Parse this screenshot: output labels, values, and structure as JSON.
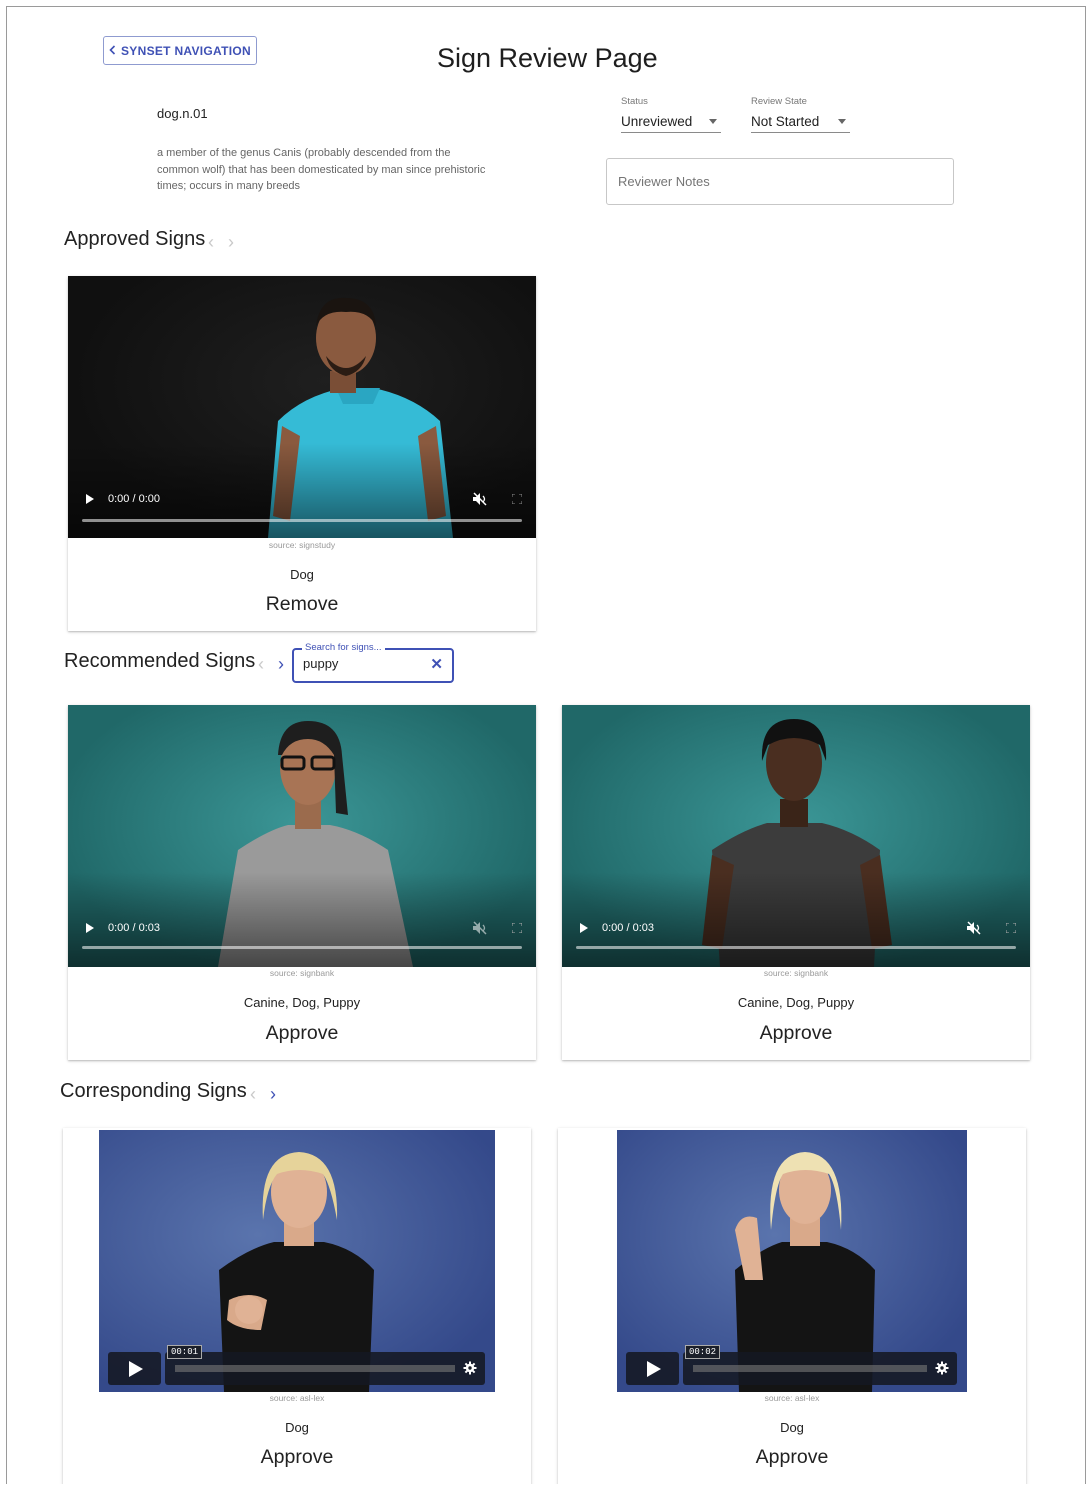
{
  "header": {
    "nav_button_label": "SYNSET NAVIGATION",
    "page_title": "Sign Review Page"
  },
  "synset": {
    "id": "dog.n.01",
    "definition": "a member of the genus Canis (probably descended from the common wolf) that has been domesticated by man since prehistoric times; occurs in many breeds"
  },
  "status": {
    "label": "Status",
    "value": "Unreviewed"
  },
  "review_state": {
    "label": "Review State",
    "value": "Not Started"
  },
  "notes": {
    "placeholder": "Reviewer Notes"
  },
  "approved": {
    "title": "Approved Signs",
    "cards": [
      {
        "time": "0:00 / 0:00",
        "source": "source: signstudy",
        "gloss": "Dog",
        "action": "Remove"
      }
    ]
  },
  "recommended": {
    "title": "Recommended Signs",
    "search_label": "Search for signs...",
    "search_value": "puppy",
    "cards": [
      {
        "time": "0:00 / 0:03",
        "source": "source: signbank",
        "gloss": "Canine, Dog, Puppy",
        "action": "Approve"
      },
      {
        "time": "0:00 / 0:03",
        "source": "source: signbank",
        "gloss": "Canine, Dog, Puppy",
        "action": "Approve"
      }
    ]
  },
  "corresponding": {
    "title": "Corresponding Signs",
    "cards": [
      {
        "time": "00:01",
        "source": "source: asl-lex",
        "gloss": "Dog",
        "action": "Approve"
      },
      {
        "time": "00:02",
        "source": "source: asl-lex",
        "gloss": "Dog",
        "action": "Approve"
      }
    ]
  },
  "icons": {
    "nav_back": "chevron-left-icon",
    "carousel_prev": "chevron-left-icon",
    "carousel_next": "chevron-right-icon",
    "dropdown": "caret-down-icon",
    "clear": "close-icon",
    "play": "play-icon",
    "mute": "volume-off-icon",
    "fullscreen": "fullscreen-icon",
    "settings": "gear-icon"
  },
  "colors": {
    "accent": "#3f51b5",
    "approved_video_bg": "#151515",
    "signbank_video_bg": "#2f7f80",
    "asl_lex_video_bg": "#3c5493"
  }
}
